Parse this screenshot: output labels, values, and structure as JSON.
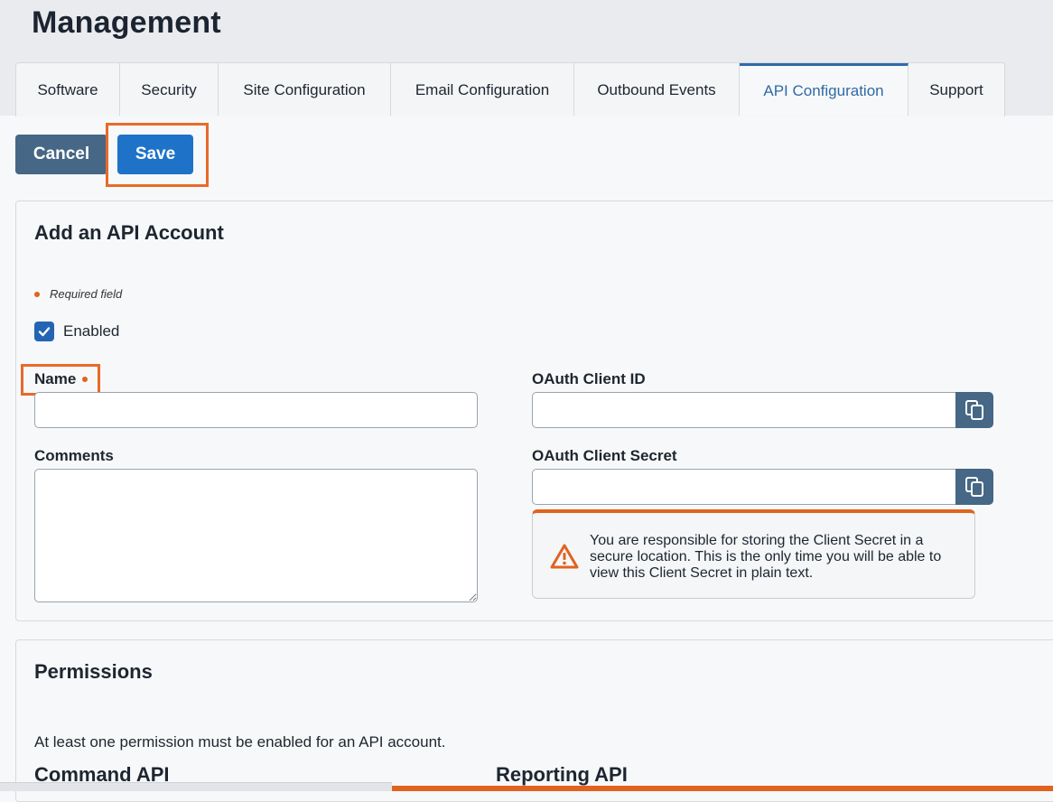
{
  "page": {
    "title": "Management"
  },
  "tabs": [
    {
      "label": "Software",
      "active": false
    },
    {
      "label": "Security",
      "active": false
    },
    {
      "label": "Site Configuration",
      "active": false
    },
    {
      "label": "Email Configuration",
      "active": false
    },
    {
      "label": "Outbound Events",
      "active": false
    },
    {
      "label": "API Configuration",
      "active": true
    },
    {
      "label": "Support",
      "active": false
    }
  ],
  "toolbar": {
    "cancel_label": "Cancel",
    "save_label": "Save"
  },
  "account_card": {
    "title": "Add an API Account",
    "required_note": "Required field",
    "enabled_label": "Enabled",
    "enabled_checked": true,
    "name_label": "Name",
    "name_value": "",
    "comments_label": "Comments",
    "comments_value": "",
    "client_id_label": "OAuth Client ID",
    "client_id_value": "",
    "client_secret_label": "OAuth Client Secret",
    "client_secret_value": "",
    "warning_text": "You are responsible for storing the Client Secret in a secure location. This is the only time you will be able to view this Client Secret in plain text."
  },
  "permissions_card": {
    "title": "Permissions",
    "note": "At least one permission must be enabled for an API account.",
    "command_api_label": "Command API",
    "reporting_api_label": "Reporting API"
  },
  "icons": {
    "copy": "copy-icon",
    "warning": "warning-triangle-icon",
    "check": "checkmark-icon"
  },
  "colors": {
    "accent": "#2f6aa6",
    "save": "#1e73c8",
    "cancel": "#466785",
    "highlight": "#e86a2b",
    "required": "#e0631f"
  }
}
